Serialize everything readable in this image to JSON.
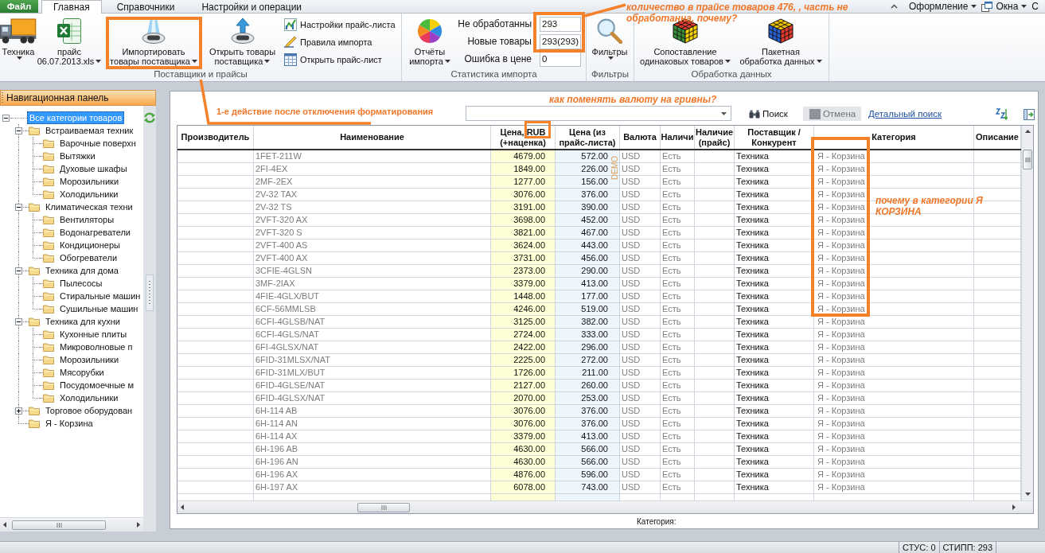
{
  "menu": {
    "file_button": "Файл",
    "tabs": [
      {
        "label": "Главная",
        "selected": true
      },
      {
        "label": "Справочники",
        "selected": false
      },
      {
        "label": "Настройки и операции",
        "selected": false
      }
    ],
    "right": [
      {
        "label": "Оформление",
        "dropdown": true
      },
      {
        "label": "Окна",
        "dropdown": true
      },
      {
        "label": "С",
        "dropdown": false
      }
    ]
  },
  "ribbon": {
    "groups": [
      {
        "label": "Поставщики и прайсы",
        "items": [
          {
            "kind": "large",
            "lines": [
              "Техника"
            ],
            "dropdown": true
          },
          {
            "kind": "large",
            "lines": [
              "прайс",
              "06.07.2013.xls"
            ],
            "dropdown": true
          },
          {
            "kind": "large",
            "lines": [
              "Импортировать",
              "товары поставщика"
            ],
            "dropdown": true
          },
          {
            "kind": "large",
            "lines": [
              "Открыть товары",
              "поставщика"
            ],
            "dropdown": true
          },
          {
            "kind": "small_list",
            "entries": [
              "Настройки прайс-листа",
              "Правила импорта",
              "Открыть прайс-лист"
            ]
          }
        ]
      },
      {
        "label": "Статистика импорта",
        "items": [
          {
            "kind": "large",
            "lines": [
              "Отчёты",
              "импорта"
            ],
            "dropdown": true
          },
          {
            "kind": "stats",
            "fields": [
              {
                "label": "Не обработанны",
                "value": "293"
              },
              {
                "label": "Новые товары",
                "value": "293(293)"
              },
              {
                "label": "Ошибка в цене",
                "value": "0"
              }
            ]
          }
        ]
      },
      {
        "label": "Фильтры",
        "items": [
          {
            "kind": "large",
            "lines": [
              "Фильтры"
            ],
            "dropdown": true
          }
        ]
      },
      {
        "label": "Обработка данных",
        "items": [
          {
            "kind": "large",
            "lines": [
              "Сопоставление",
              "одинаковых товаров"
            ],
            "dropdown": true
          },
          {
            "kind": "large",
            "lines": [
              "Пакетная",
              "обработка данных"
            ],
            "dropdown": true
          }
        ]
      }
    ]
  },
  "navigation": {
    "title": "Навигационная панель",
    "tree": [
      {
        "label": "Все категории товаров",
        "selected": true,
        "expanded": true,
        "children": [
          {
            "label": "Встраиваемая техник",
            "selected": false,
            "expanded": true,
            "children": [
              {
                "label": "Варочные поверхн",
                "selected": false
              },
              {
                "label": "Вытяжки",
                "selected": false
              },
              {
                "label": "Духовые шкафы",
                "selected": false
              },
              {
                "label": "Морозильники",
                "selected": false
              },
              {
                "label": "Холодильники",
                "selected": false
              }
            ]
          },
          {
            "label": "Климатическая техни",
            "selected": false,
            "expanded": true,
            "children": [
              {
                "label": "Вентиляторы",
                "selected": false
              },
              {
                "label": "Водонагреватели",
                "selected": false
              },
              {
                "label": "Кондиционеры",
                "selected": false
              },
              {
                "label": "Обогреватели",
                "selected": false
              }
            ]
          },
          {
            "label": "Техника для дома",
            "selected": false,
            "expanded": true,
            "children": [
              {
                "label": "Пылесосы",
                "selected": false
              },
              {
                "label": "Стиральные машин",
                "selected": false
              },
              {
                "label": "Сушильные машин",
                "selected": false
              }
            ]
          },
          {
            "label": "Техника для кухни",
            "selected": false,
            "expanded": true,
            "children": [
              {
                "label": "Кухонные плиты",
                "selected": false
              },
              {
                "label": "Микроволновые п",
                "selected": false
              },
              {
                "label": "Морозильники",
                "selected": false
              },
              {
                "label": "Мясорубки",
                "selected": false
              },
              {
                "label": "Посудомоечные м",
                "selected": false
              },
              {
                "label": "Холодильники",
                "selected": false
              }
            ]
          },
          {
            "label": "Торговое оборудован",
            "selected": false,
            "expanded": false
          },
          {
            "label": "Я - Корзина",
            "selected": false
          }
        ]
      }
    ]
  },
  "toolbar": {
    "search_button": "Поиск",
    "cancel_button": {
      "label": "Отмена",
      "disabled": true
    },
    "detail_link": "Детальный поиск"
  },
  "grid": {
    "columns": [
      "Производитель",
      "Наименование",
      "Цена, RUB (+наценка)",
      "Цена (из прайс-листа)",
      "Валюта",
      "Наличи",
      "Наличие (прайс)",
      "Поставщик / Конкурент",
      "Категория",
      "Описание"
    ],
    "demo_mark": "DEMO",
    "rows": [
      {
        "name": "1FET-211W",
        "price": "4679.00",
        "price_list": "572.00",
        "currency": "USD",
        "stock": "Есть",
        "supplier": "Техника",
        "category": "Я - Корзина"
      },
      {
        "name": "2FI-4EX",
        "price": "1849.00",
        "price_list": "226.00",
        "currency": "USD",
        "stock": "Есть",
        "supplier": "Техника",
        "category": "Я - Корзина"
      },
      {
        "name": "2MF-2EX",
        "price": "1277.00",
        "price_list": "156.00",
        "currency": "USD",
        "stock": "Есть",
        "supplier": "Техника",
        "category": "Я - Корзина"
      },
      {
        "name": "2V-32 TAX",
        "price": "3076.00",
        "price_list": "376.00",
        "currency": "USD",
        "stock": "Есть",
        "supplier": "Техника",
        "category": "Я - Корзина"
      },
      {
        "name": "2V-32 TS",
        "price": "3191.00",
        "price_list": "390.00",
        "currency": "USD",
        "stock": "Есть",
        "supplier": "Техника",
        "category": "Я - Корзина"
      },
      {
        "name": "2VFT-320 AX",
        "price": "3698.00",
        "price_list": "452.00",
        "currency": "USD",
        "stock": "Есть",
        "supplier": "Техника",
        "category": "Я - Корзина"
      },
      {
        "name": "2VFT-320 S",
        "price": "3821.00",
        "price_list": "467.00",
        "currency": "USD",
        "stock": "Есть",
        "supplier": "Техника",
        "category": "Я - Корзина"
      },
      {
        "name": "2VFT-400 AS",
        "price": "3624.00",
        "price_list": "443.00",
        "currency": "USD",
        "stock": "Есть",
        "supplier": "Техника",
        "category": "Я - Корзина"
      },
      {
        "name": "2VFT-400 AX",
        "price": "3731.00",
        "price_list": "456.00",
        "currency": "USD",
        "stock": "Есть",
        "supplier": "Техника",
        "category": "Я - Корзина"
      },
      {
        "name": "3CFIE-4GLSN",
        "price": "2373.00",
        "price_list": "290.00",
        "currency": "USD",
        "stock": "Есть",
        "supplier": "Техника",
        "category": "Я - Корзина"
      },
      {
        "name": "3MF-2IAX",
        "price": "3379.00",
        "price_list": "413.00",
        "currency": "USD",
        "stock": "Есть",
        "supplier": "Техника",
        "category": "Я - Корзина"
      },
      {
        "name": "4FIE-4GLX/BUT",
        "price": "1448.00",
        "price_list": "177.00",
        "currency": "USD",
        "stock": "Есть",
        "supplier": "Техника",
        "category": "Я - Корзина"
      },
      {
        "name": "6CF-56MMLSB",
        "price": "4246.00",
        "price_list": "519.00",
        "currency": "USD",
        "stock": "Есть",
        "supplier": "Техника",
        "category": "Я - Корзина"
      },
      {
        "name": "6CFI-4GLSB/NAT",
        "price": "3125.00",
        "price_list": "382.00",
        "currency": "USD",
        "stock": "Есть",
        "supplier": "Техника",
        "category": "Я - Корзина"
      },
      {
        "name": "6CFI-4GLS/NAT",
        "price": "2724.00",
        "price_list": "333.00",
        "currency": "USD",
        "stock": "Есть",
        "supplier": "Техника",
        "category": "Я - Корзина"
      },
      {
        "name": "6FI-4GLSX/NAT",
        "price": "2422.00",
        "price_list": "296.00",
        "currency": "USD",
        "stock": "Есть",
        "supplier": "Техника",
        "category": "Я - Корзина"
      },
      {
        "name": "6FID-31MLSX/NAT",
        "price": "2225.00",
        "price_list": "272.00",
        "currency": "USD",
        "stock": "Есть",
        "supplier": "Техника",
        "category": "Я - Корзина"
      },
      {
        "name": "6FID-31MLX/BUT",
        "price": "1726.00",
        "price_list": "211.00",
        "currency": "USD",
        "stock": "Есть",
        "supplier": "Техника",
        "category": "Я - Корзина"
      },
      {
        "name": "6FID-4GLSE/NAT",
        "price": "2127.00",
        "price_list": "260.00",
        "currency": "USD",
        "stock": "Есть",
        "supplier": "Техника",
        "category": "Я - Корзина"
      },
      {
        "name": "6FID-4GLSX/NAT",
        "price": "2070.00",
        "price_list": "253.00",
        "currency": "USD",
        "stock": "Есть",
        "supplier": "Техника",
        "category": "Я - Корзина"
      },
      {
        "name": "6H-114 AB",
        "price": "3076.00",
        "price_list": "376.00",
        "currency": "USD",
        "stock": "Есть",
        "supplier": "Техника",
        "category": "Я - Корзина"
      },
      {
        "name": "6H-114 AN",
        "price": "3076.00",
        "price_list": "376.00",
        "currency": "USD",
        "stock": "Есть",
        "supplier": "Техника",
        "category": "Я - Корзина"
      },
      {
        "name": "6H-114 AX",
        "price": "3379.00",
        "price_list": "413.00",
        "currency": "USD",
        "stock": "Есть",
        "supplier": "Техника",
        "category": "Я - Корзина"
      },
      {
        "name": "6H-196 AB",
        "price": "4630.00",
        "price_list": "566.00",
        "currency": "USD",
        "stock": "Есть",
        "supplier": "Техника",
        "category": "Я - Корзина"
      },
      {
        "name": "6H-196 AN",
        "price": "4630.00",
        "price_list": "566.00",
        "currency": "USD",
        "stock": "Есть",
        "supplier": "Техника",
        "category": "Я - Корзина"
      },
      {
        "name": "6H-196 AX",
        "price": "4876.00",
        "price_list": "596.00",
        "currency": "USD",
        "stock": "Есть",
        "supplier": "Техника",
        "category": "Я - Корзина"
      },
      {
        "name": "6H-197 AX",
        "price": "6078.00",
        "price_list": "743.00",
        "currency": "USD",
        "stock": "Есть",
        "supplier": "Техника",
        "category": "Я - Корзина"
      }
    ]
  },
  "detail_label": "Категория:",
  "status_bar": [
    "СТУС: 0",
    "СТИПП: 293"
  ],
  "annotations": [
    {
      "kind": "frame"
    },
    {
      "kind": "connector"
    },
    {
      "kind": "note",
      "text": "1-е действие после отключения форматирования"
    },
    {
      "kind": "frame"
    },
    {
      "kind": "connector"
    },
    {
      "kind": "note",
      "text": "количество в прайсе товаров 476, , часть не обработанна, почему?"
    },
    {
      "kind": "note",
      "text": "как поменять валюту на гривны?"
    },
    {
      "kind": "frame"
    },
    {
      "kind": "frame"
    },
    {
      "kind": "note",
      "text": "почему в категории Я КОРЗИНА"
    }
  ]
}
